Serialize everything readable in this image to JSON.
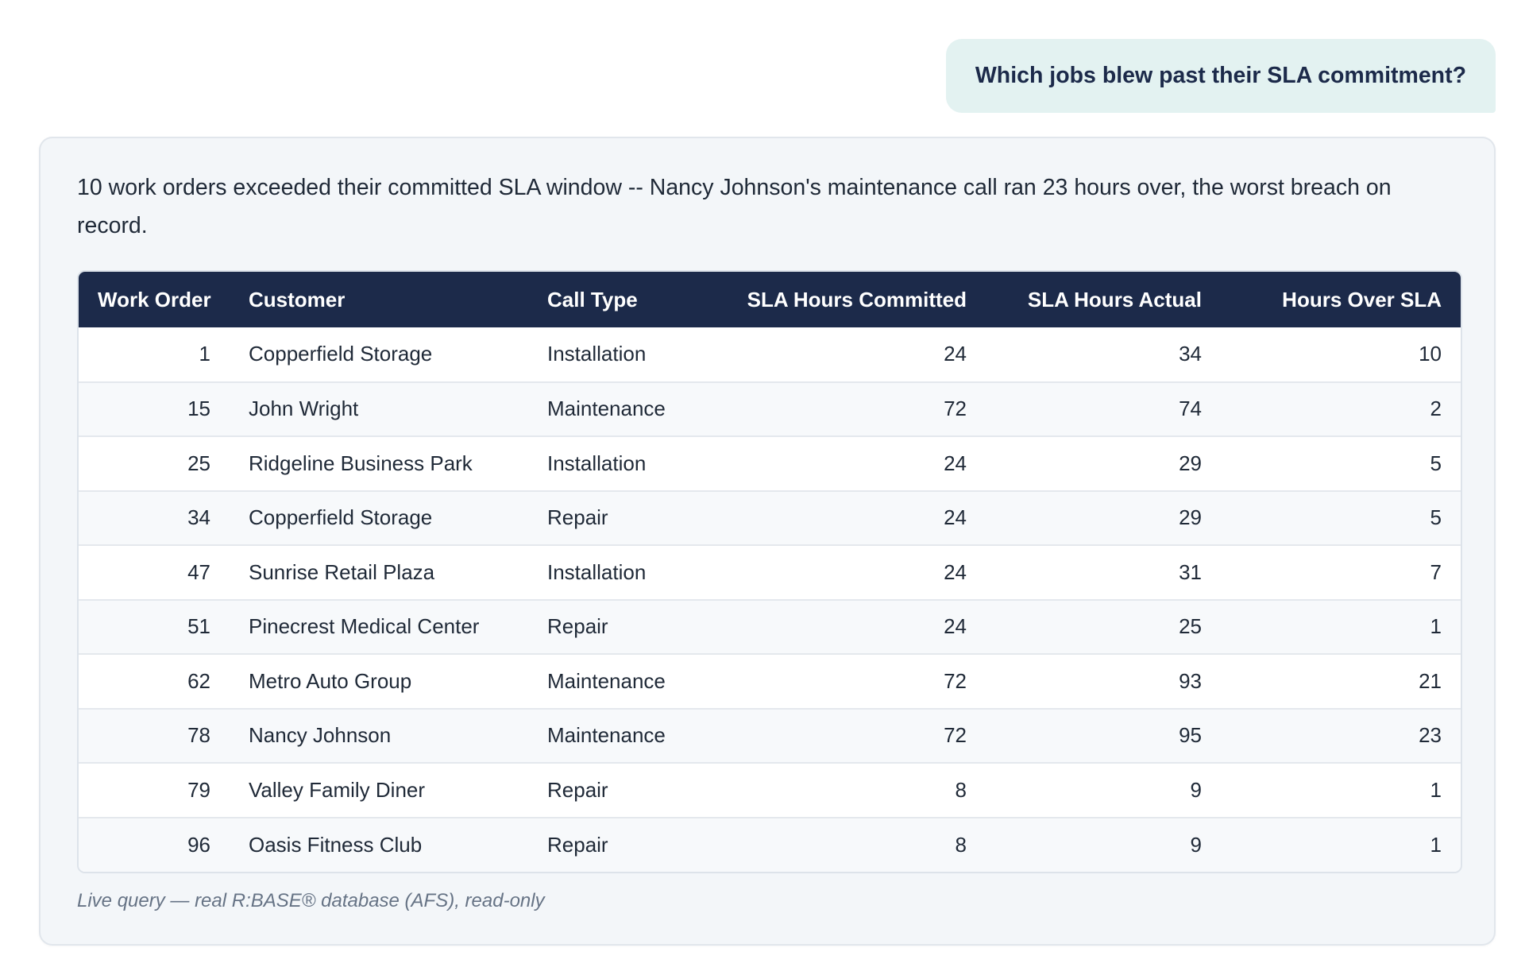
{
  "user_message": "Which jobs blew past their SLA commitment?",
  "answer": {
    "summary": "10 work orders exceeded their committed SLA window -- Nancy Johnson's maintenance call ran 23 hours over, the worst breach on record.",
    "footnote": "Live query — real R:BASE® database (AFS), read-only"
  },
  "table": {
    "headers": [
      "Work Order",
      "Customer",
      "Call Type",
      "SLA Hours Committed",
      "SLA Hours Actual",
      "Hours Over SLA"
    ],
    "rows": [
      [
        "1",
        "Copperfield Storage",
        "Installation",
        "24",
        "34",
        "10"
      ],
      [
        "15",
        "John Wright",
        "Maintenance",
        "72",
        "74",
        "2"
      ],
      [
        "25",
        "Ridgeline Business Park",
        "Installation",
        "24",
        "29",
        "5"
      ],
      [
        "34",
        "Copperfield Storage",
        "Repair",
        "24",
        "29",
        "5"
      ],
      [
        "47",
        "Sunrise Retail Plaza",
        "Installation",
        "24",
        "31",
        "7"
      ],
      [
        "51",
        "Pinecrest Medical Center",
        "Repair",
        "24",
        "25",
        "1"
      ],
      [
        "62",
        "Metro Auto Group",
        "Maintenance",
        "72",
        "93",
        "21"
      ],
      [
        "78",
        "Nancy Johnson",
        "Maintenance",
        "72",
        "95",
        "23"
      ],
      [
        "79",
        "Valley Family Diner",
        "Repair",
        "8",
        "9",
        "1"
      ],
      [
        "96",
        "Oasis Fitness Club",
        "Repair",
        "8",
        "9",
        "1"
      ]
    ]
  },
  "colors": {
    "header_bg": "#1c2a4a",
    "user_bubble_bg": "#e3f2f1",
    "card_bg": "#f3f6f9"
  }
}
